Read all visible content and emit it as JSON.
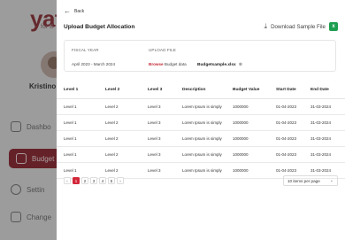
{
  "background": {
    "logo": "yat",
    "logo_sub": "for B",
    "user_name": "Kristino",
    "nav": [
      {
        "label": "Dashbo",
        "icon": "grid-icon"
      },
      {
        "label": "Budget",
        "icon": "wallet-icon"
      },
      {
        "label": "Settin",
        "icon": "gear-icon"
      },
      {
        "label": "Change",
        "icon": "lock-icon"
      }
    ]
  },
  "panel": {
    "back_label": "Back",
    "title": "Upload Budget Allocation",
    "download_label": "Download Sample File",
    "info": {
      "fiscal_year_header": "FISCAL YEAR",
      "upload_file_header": "UPLOAD FILE",
      "fiscal_year_value": "April 2023 - March 2024",
      "browse_label": "Browse",
      "budget_data_label": "Budget data",
      "file_name": "Budgetsample.xlsx",
      "remove_label": "⊗"
    },
    "table": {
      "headers": [
        "Level 1",
        "Level 2",
        "Level 3",
        "Description",
        "Budget Value",
        "Start Date",
        "End Date"
      ],
      "rows": [
        [
          "Level 1",
          "Level 2",
          "Level 3",
          "Lorem Ipsum is simply",
          "1000000",
          "01-04-2023",
          "31-03-2024"
        ],
        [
          "Level 1",
          "Level 2",
          "Level 3",
          "Lorem Ipsum is simply",
          "1000000",
          "01-04-2023",
          "31-03-2024"
        ],
        [
          "Level 1",
          "Level 2",
          "Level 3",
          "Lorem Ipsum is simply",
          "1000000",
          "01-04-2023",
          "31-03-2024"
        ],
        [
          "Level 1",
          "Level 2",
          "Level 3",
          "Lorem Ipsum is simply",
          "1000000",
          "01-04-2023",
          "31-03-2024"
        ],
        [
          "Level 1",
          "Level 2",
          "Level 3",
          "Lorem Ipsum is simply",
          "1000000",
          "01-04-2023",
          "31-03-2024"
        ]
      ]
    },
    "pagination": {
      "prev": "‹",
      "pages": [
        "1",
        "2",
        "3",
        "4",
        "5"
      ],
      "active_page": "1",
      "next": "›",
      "per_page": "10 items per page"
    }
  },
  "colors": {
    "accent": "#d3273a",
    "excel": "#1e9e4f"
  }
}
